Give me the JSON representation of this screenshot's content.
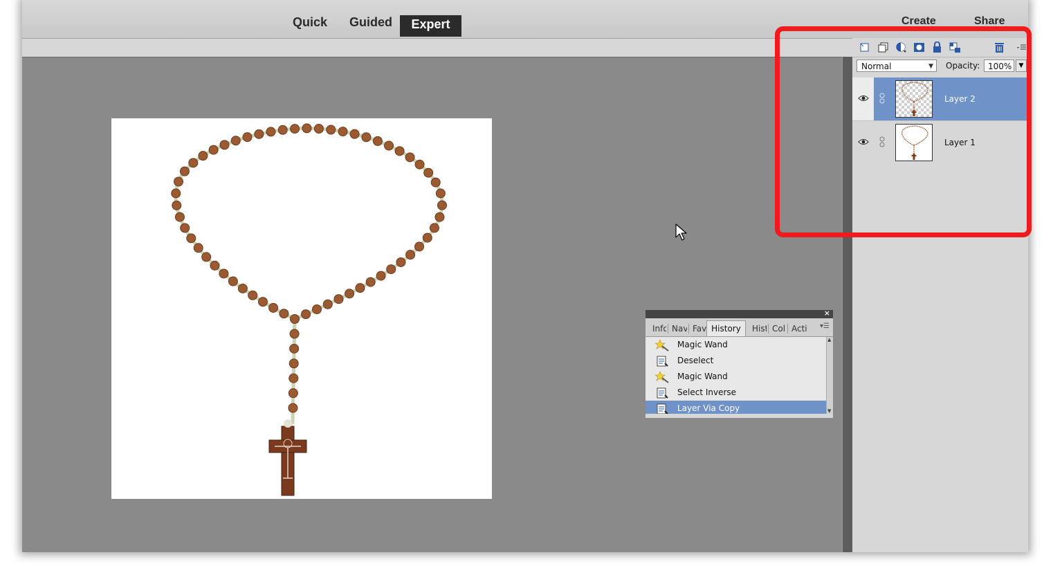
{
  "mode_tabs": {
    "quick": "Quick",
    "guided": "Guided",
    "expert": "Expert"
  },
  "top_right": {
    "create": "Create",
    "share": "Share"
  },
  "layers_panel": {
    "blend_mode": "Normal",
    "opacity_label": "Opacity:",
    "opacity_value": "100%",
    "layers": [
      {
        "name": "Layer 2",
        "selected": true,
        "visible": true,
        "transparent": true
      },
      {
        "name": "Layer 1",
        "selected": false,
        "visible": true,
        "transparent": false
      }
    ],
    "toolbar_icons": [
      "new-layer-icon",
      "new-group-icon",
      "adjustment-layer-icon",
      "layer-mask-icon",
      "lock-all-icon",
      "lock-transparency-icon",
      "delete-layer-icon",
      "panel-menu-icon"
    ]
  },
  "history_panel": {
    "tabs": [
      "Info",
      "Nav",
      "Fav",
      "History",
      "Hist",
      "Col",
      "Acti"
    ],
    "active_tab": "History",
    "items": [
      {
        "label": "Magic Wand",
        "icon": "magic-wand-icon",
        "selected": false
      },
      {
        "label": "Deselect",
        "icon": "document-step-icon",
        "selected": false
      },
      {
        "label": "Magic Wand",
        "icon": "magic-wand-icon",
        "selected": false
      },
      {
        "label": "Select Inverse",
        "icon": "document-step-icon",
        "selected": false
      },
      {
        "label": "Layer Via Copy",
        "icon": "document-step-icon",
        "selected": true
      }
    ]
  },
  "colors": {
    "selection_blue": "#6f93c8",
    "highlight_red": "#ee1c1c",
    "workspace_gray": "#8a8a8a",
    "bead_brown": "#9a5a32",
    "cross_brown": "#7a3a1e"
  }
}
